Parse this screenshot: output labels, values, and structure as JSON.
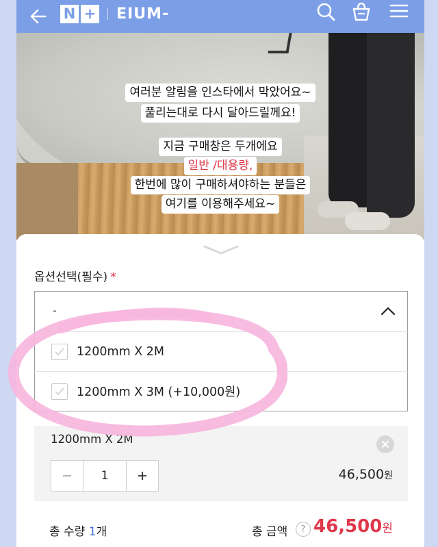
{
  "header": {
    "logo_n": "N",
    "logo_plus": "+",
    "brand": "EIUM-"
  },
  "hero": {
    "captions": [
      {
        "text": "여러분 알림을 인스타에서 막았어요~",
        "color": "black"
      },
      {
        "text": "풀리는대로 다시 달아드릴께요!",
        "color": "black"
      },
      {
        "text": "지금 구매창은 두개에요",
        "color": "black"
      },
      {
        "text": "일반 /대용량,",
        "color": "red"
      },
      {
        "text": "한번에 많이 구매하셔야하는 분들은",
        "color": "black"
      },
      {
        "text": "여기를 이용해주세요~",
        "color": "black"
      }
    ]
  },
  "options": {
    "label": "옵션선택(필수)",
    "required_mark": "*",
    "selected_value": "-",
    "items": [
      {
        "label": "1200mm X 2M"
      },
      {
        "label": "1200mm X 3M (+10,000원)"
      }
    ]
  },
  "selected_item": {
    "name": "1200mm X 2M",
    "quantity": "1",
    "price": "46,500",
    "currency": "원"
  },
  "totals": {
    "qty_label": "총 수량",
    "qty_value": "1",
    "qty_unit": "개",
    "amount_label": "총 금액",
    "help": "?",
    "amount": "46,500",
    "currency": "원"
  },
  "colors": {
    "header_bg": "#7c9ee6",
    "accent_red": "#e0384b",
    "accent_blue": "#3f6fd8",
    "highlight_pink": "#f7b6de"
  },
  "icons": [
    "back-arrow-icon",
    "search-icon",
    "shopping-bag-icon",
    "hamburger-menu-icon",
    "chevron-down-icon",
    "chevron-up-icon",
    "check-icon",
    "close-icon",
    "help-icon"
  ]
}
